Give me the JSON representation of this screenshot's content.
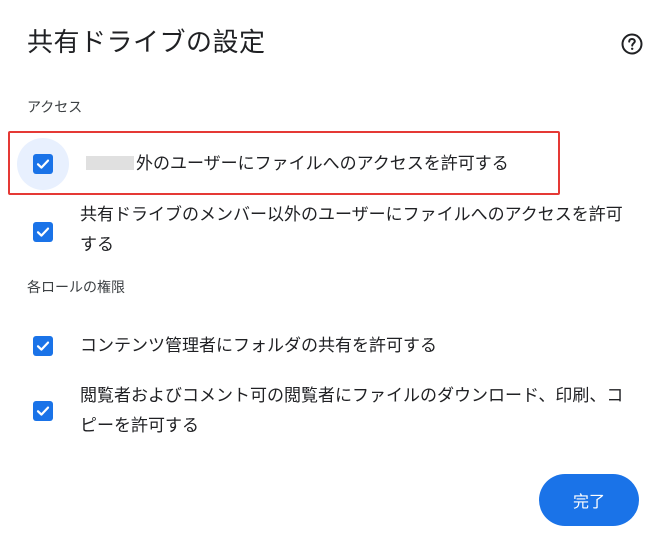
{
  "dialog": {
    "title": "共有ドライブの設定",
    "help_icon": "help-circle-icon"
  },
  "access": {
    "section_label": "アクセス",
    "options": [
      {
        "label": "外のユーザーにファイルへのアクセスを許可する",
        "checked": true
      },
      {
        "label": "共有ドライブのメンバー以外のユーザーにファイルへのアクセスを許可する",
        "checked": true
      }
    ]
  },
  "roles": {
    "section_label": "各ロールの権限",
    "options": [
      {
        "label": "コンテンツ管理者にフォルダの共有を許可する",
        "checked": true
      },
      {
        "label": "閲覧者およびコメント可の閲覧者にファイルのダウンロード、印刷、コピーを許可する",
        "checked": true
      }
    ]
  },
  "footer": {
    "done_label": "完了"
  },
  "colors": {
    "accent": "#1a73e8",
    "highlight_border": "#e53935",
    "focus_halo": "#e8f0fe"
  }
}
